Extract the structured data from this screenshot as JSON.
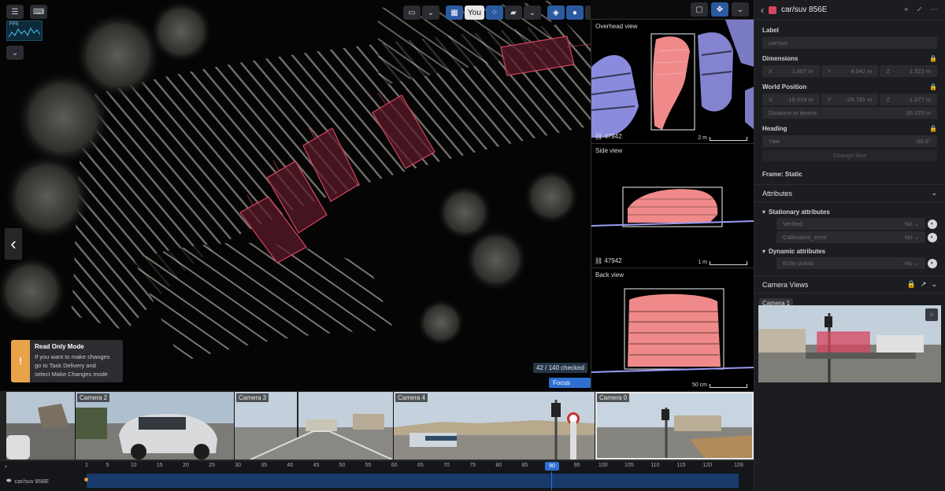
{
  "toolbar": {
    "view_label": "You"
  },
  "fps": {
    "label": "FPS"
  },
  "readonly": {
    "title": "Read Only Mode",
    "line1": "If you want to make changes",
    "line2": "go to Task Delivery and",
    "line3": "select Make Changes mode"
  },
  "status": {
    "checked": "42 / 140 checked",
    "focus_mode": "Focus mode"
  },
  "views": {
    "overhead": {
      "title": "Overhead view",
      "id": "47942",
      "scale": "2 m"
    },
    "side": {
      "title": "Side view",
      "id": "47942",
      "scale": "1 m"
    },
    "back": {
      "title": "Back view",
      "scale": "50 cm"
    }
  },
  "panel": {
    "object_title": "car/suv 856E",
    "label_section": "Label",
    "label_value": "car/suv",
    "dimensions_section": "Dimensions",
    "dimensions": [
      {
        "axis": "X",
        "value": "1.807 m"
      },
      {
        "axis": "Y",
        "value": "4.042 m"
      },
      {
        "axis": "Z",
        "value": "1.522 m"
      }
    ],
    "world_position_section": "World Position",
    "world_position": [
      {
        "axis": "X",
        "value": "-19.019 m"
      },
      {
        "axis": "Y",
        "value": "-29.791 m"
      },
      {
        "axis": "Z",
        "value": "-1.577 m"
      }
    ],
    "distance_label": "Distance to device",
    "distance_value": "35.379 m",
    "heading_section": "Heading",
    "yaw_label": "Yaw",
    "yaw_value": "-56.6°",
    "change_button": "Change face",
    "frame": "Frame: Static",
    "attributes_section": "Attributes",
    "stationary_label": "Stationary attributes",
    "stationary": [
      {
        "name": "Verified",
        "value": "No"
      },
      {
        "name": "Calibration_error",
        "value": "No"
      }
    ],
    "dynamic_label": "Dynamic attributes",
    "dynamic": [
      {
        "name": "Echo points",
        "value": "No"
      }
    ],
    "camera_views_section": "Camera Views",
    "camera_tag": "Camera 1"
  },
  "cameras": [
    {
      "label": ""
    },
    {
      "label": "Camera 2"
    },
    {
      "label": "Camera 3"
    },
    {
      "label": "Camera 4"
    },
    {
      "label": "Camera 0"
    }
  ],
  "timeline": {
    "ticks": [
      "1",
      "5",
      "10",
      "15",
      "20",
      "25",
      "30",
      "35",
      "40",
      "45",
      "50",
      "55",
      "60",
      "65",
      "70",
      "75",
      "80",
      "85",
      "90",
      "95",
      "100",
      "105",
      "110",
      "115",
      "120",
      "126"
    ],
    "current": "90",
    "track_label": "car/suv 856E"
  },
  "colors": {
    "accent": "#2f6fd1",
    "cuboid": "#d6455f",
    "overhead_points": "#9a9af5",
    "object_points": "#f08a8a",
    "warning": "#e8a24a"
  }
}
